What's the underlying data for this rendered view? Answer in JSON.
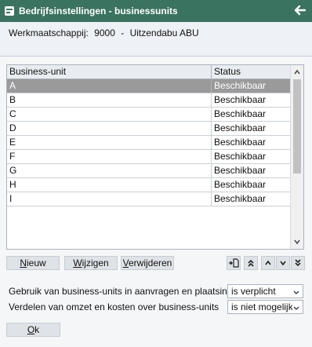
{
  "window": {
    "title": "Bedrijfsinstellingen - businessunits"
  },
  "company": {
    "label": "Werkmaatschappij:",
    "code": "9000",
    "separator": "-",
    "name": "Uitzendabu ABU"
  },
  "grid": {
    "columns": [
      "Business-unit",
      "Status"
    ],
    "rows": [
      {
        "unit": "A",
        "status": "Beschikbaar",
        "selected": true
      },
      {
        "unit": "B",
        "status": "Beschikbaar"
      },
      {
        "unit": "C",
        "status": "Beschikbaar"
      },
      {
        "unit": "D",
        "status": "Beschikbaar"
      },
      {
        "unit": "E",
        "status": "Beschikbaar"
      },
      {
        "unit": "F",
        "status": "Beschikbaar"
      },
      {
        "unit": "G",
        "status": "Beschikbaar"
      },
      {
        "unit": "H",
        "status": "Beschikbaar"
      },
      {
        "unit": "I",
        "status": "Beschikbaar"
      }
    ]
  },
  "buttons": {
    "new": {
      "hotkey": "N",
      "rest": "ieuw"
    },
    "edit": {
      "hotkey": "W",
      "rest": "ijzigen"
    },
    "delete": {
      "hotkey": "V",
      "rest": "erwijderen"
    },
    "ok": {
      "hotkey": "O",
      "rest": "k"
    }
  },
  "nav_icons": [
    "export-icon",
    "move-top-icon",
    "move-up-icon",
    "move-down-icon",
    "move-bottom-icon"
  ],
  "settings": [
    {
      "label": "Gebruik van business-units in aanvragen en plaatsingen",
      "value": "is verplicht"
    },
    {
      "label": "Verdelen van omzet en kosten over business-units",
      "value": "is niet mogelijk"
    }
  ],
  "colors": {
    "titlebar": "#3a7360",
    "selected_row": "#9a9a9a",
    "header_band": "#eef1f5"
  }
}
